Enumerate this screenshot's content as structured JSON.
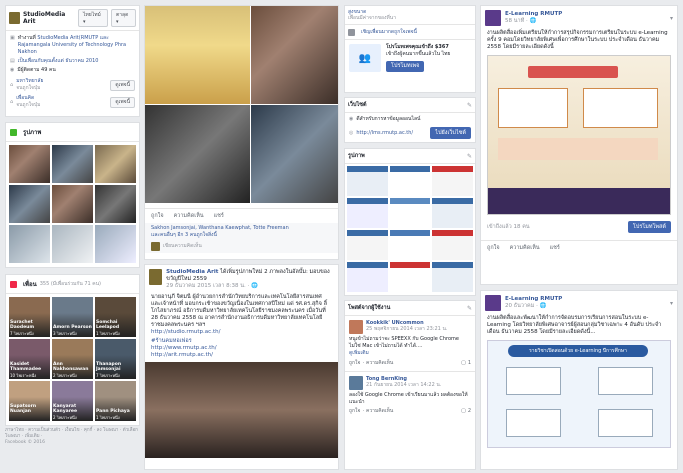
{
  "header": {
    "page_name": "StudioMedia Arit",
    "lang": "ไทยไทม์ ▾",
    "lang2": "ตาลุด ▾"
  },
  "info": {
    "address_prefix": "ทำงานที่",
    "address": "StudioMedia Arit(RMUTP และ Rajamangala University of Technology Phra Nakhon",
    "joined": "เป็นเพื่อนกับคุณตั้งแต่ ธันวาคม 2010",
    "followers": "มีผู้ติดตาม 49 คน",
    "mahawit": "มหาวิทยาลัย",
    "mahawit_sub": "จนถูกใจปุ่ม",
    "phuean": "เพื่อนคิด",
    "phuean_sub": "จนถูกใจปุ่ม",
    "btn1": "ดูเพจนี้",
    "btn2": "ดูเพจนี้"
  },
  "photos": {
    "title": "รูปภาพ"
  },
  "friends": {
    "title": "เพื่อน",
    "count": "355 (มีเพื่อนร่วมกัน 71 คน)",
    "names": [
      "Surachet Daodeum",
      "Amorn Pearson",
      "Somchai Leelapod",
      "Kasidet Thammadee",
      "Ann Nakhonsawan",
      "Thanapon Jamsonjai",
      "Supatsorn Nuanjan",
      "Kanyarat Kanyaree",
      "Pann Pichaya"
    ],
    "counts": [
      "7 ไพเราะหนึ่ง",
      "3 ไพเราะหนึ่ง",
      "1 ไพเราะหนึ่ง",
      "10 ไพเราะหนึ่ง",
      "2 ไพเราะหนึ่ง",
      "7 ไพเราะหนึ่ง",
      "",
      "2 ไพเราะหนึ่ง",
      "1 ไพเราะหนึ่ง"
    ]
  },
  "footer": {
    "text": "ภาษาไทย · ความเป็นส่วนตัว · เงื่อนไข · คุกกี้ · ลง โฆษณา · ตัวเลือกโฆษณา · เพิ่มเติม ·",
    "copy": "Facebook © 2016"
  },
  "post1": {
    "like": "ถูกใจ",
    "comment": "ความคิดเห็น",
    "share": "แชร์",
    "liked_by": "Sakhon Jamsonjai, Wanthana Kaewphat, Totte Freeman",
    "more": "และคนอื่นๆ อีก 3 คนถูกใจสิ่งนี้",
    "write": "เขียนความคิดเห็น"
  },
  "post2": {
    "author": "StudioMedia Arit",
    "action": "ได้เพิ่มรูปภาพใหม่ 2 ภาพลงในอัลบั้ม: มอบของขวัญปีใหม่ 2559",
    "date": "29 ธันวาคม 2015 เวลา 8:38 น. · 🌐",
    "body": "นายอานุภี จิตมนี ผู้อำนวยการสำนักวิทยบริการและเทคโนโลยีสารสนเทศ และเจ้าหน้าที่ มอบกระเช้าของขวัญเนื่องในเทศกาลปีใหม่ แด่ รศ.ดร.สุกิจ ลิ์ โกไสยาภรณ์ อธิการบดีมหาวิทยาลัยเทคโนโลยีราชมงคลพระนคร เมื่อวันที่ 28 ธันวาคม 2558 ณ อาคารสำนักงานอธิการบดีมหาวิทยาลัยเทคโนโลยีราชมงคลพระนคร ฯลฯ",
    "link1": "http://studio.rmutp.ac.th/",
    "tag": "#ร้านคมหอเฟอร",
    "link2": "http://www.rmutp.ac.th/",
    "link3": "http://arit.rmutp.ac.th/"
  },
  "right1": {
    "top1": "สูงขนาด",
    "top2": "เพื่อนมีค่าจากของที่นา",
    "invite": "เชิญเพื่อนมากดถูกใจเพจนี้",
    "promo1": "โปรโมทเพจคุณเข้าถึง $367",
    "promo2": "เข้าถึงผู้คนมากขึ้นแล้วใน ไทย",
    "promo_btn": "โปรโมทเพจ",
    "website_title": "เว็บไซต์",
    "website_sub": "ดีสำหรับการหาข้อมูลออนไลน์",
    "website_url": "http://lms.rmutp.ac.th/",
    "visit_btn": "ไปยังเว็บไซต์",
    "photos_title": "รูปภาพ",
    "posts_title": "โพสต์จากผู้ใช้งาน"
  },
  "comments": [
    {
      "name": "Kookkik' UNcommon",
      "date": "25 พฤศจิกายน 2014 เวลา 23:21 น.",
      "text": "หนูเข้าไม่ถามว่าจะ SPEEXX กับ Google Chrome ไม่ใช่ Mac เข้าไม่ถามได้ ทำได้....",
      "more": "ดูเพิ่มเติม",
      "count": "1"
    },
    {
      "name": "Tong BernKing",
      "date": "21 กันยายน 2014 เวลา 14:22 น.",
      "text": "ลองใช้ Google Chrome เข้าเรียนมาแล้ว ผลต้องขอให้แนะนำ",
      "count": "2"
    }
  ],
  "comment_actions": {
    "like": "ถูกใจ",
    "comment": "ความคิดเห็น"
  },
  "elearn1": {
    "name": "E-Learning RMUTP",
    "time": "58 นาที · 🌐",
    "text": "งานผลิตสื่ออเพิ่มเตรียนให้กำการสรุปกิจกรรมการเตรียนในระบบ e-Learning ครั้ง 9 คอมโดยวิทยาลัยพิเศษเพื่อการศึกษาในระบบ ประจำเดือน ธันวาคม 2558 โดยมีรายละเอียดดังนี้",
    "reach": "เข้าถึงแล้ว 18 คน",
    "boost": "โปรโมทโพสต์",
    "like": "ถูกใจ",
    "comment": "ความคิดเห็น",
    "share": "แชร์"
  },
  "elearn2": {
    "name": "E-Learning RMUTP",
    "time": "20 ธันวาคม · 🌐",
    "text": "งานผลิตสื่อและพัฒนาให้กำการจัดอบรมการเรียนการสอนในระบบ e-Learning โดยวิทยาลัยพิเศษอาจารย์ผู้สอนกลุ่มวิชาเฉพาะ 4 อันดับ ประจำเดือน ธันวาคม 2558 โดยมีรายละเอียดดังนี้...",
    "slide_title": "รายวิชาเปิดสอนด้วย e-Learning ปีการศึกษา"
  },
  "colors": {
    "accent": "#4267b2",
    "link": "#365899",
    "bg": "#e9ebee"
  }
}
